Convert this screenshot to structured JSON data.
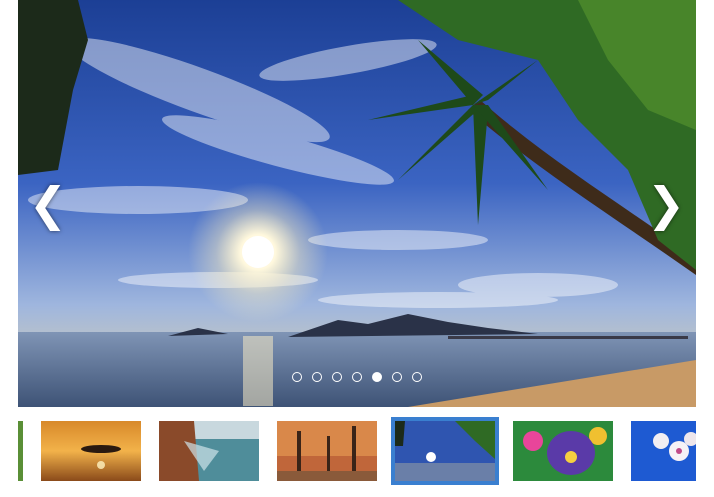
{
  "slider": {
    "prev_label": "❮",
    "next_label": "❯",
    "slide_count": 7,
    "active_index": 4
  },
  "thumbnails": [
    {
      "name": "thumb-green-edge"
    },
    {
      "name": "thumb-sunset-island"
    },
    {
      "name": "thumb-rocky-coast"
    },
    {
      "name": "thumb-autumn-trees"
    },
    {
      "name": "thumb-palm-beach"
    },
    {
      "name": "thumb-purple-pansy"
    },
    {
      "name": "thumb-white-orchid"
    }
  ],
  "colors": {
    "active_border": "#3a7fd0",
    "dot": "#ffffff"
  }
}
